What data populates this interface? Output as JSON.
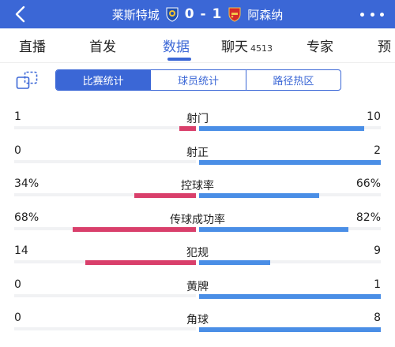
{
  "header": {
    "home_team": "莱斯特城",
    "away_team": "阿森纳",
    "score": "0 - 1",
    "home_badge_icon": "leicester-badge-icon",
    "away_badge_icon": "arsenal-badge-icon",
    "bg_color": "#3b67d6"
  },
  "tabs": [
    {
      "label": "直播",
      "count": ""
    },
    {
      "label": "首发",
      "count": ""
    },
    {
      "label": "数据",
      "count": "",
      "active": true
    },
    {
      "label": "聊天",
      "count": "4513"
    },
    {
      "label": "专家",
      "count": ""
    },
    {
      "label": "预",
      "count": ""
    }
  ],
  "subtabs": [
    {
      "label": "比赛统计",
      "active": true
    },
    {
      "label": "球员统计",
      "active": false
    },
    {
      "label": "路径热区",
      "active": false
    }
  ],
  "colors": {
    "home_bar": "#d93f6b",
    "away_bar": "#4a8ee6",
    "accent": "#3b67d6"
  },
  "stats": [
    {
      "label": "射门",
      "home": "1",
      "away": "10",
      "home_share": 0.09,
      "away_share": 0.91
    },
    {
      "label": "射正",
      "home": "0",
      "away": "2",
      "home_share": 0.0,
      "away_share": 1.0
    },
    {
      "label": "控球率",
      "home": "34%",
      "away": "66%",
      "home_share": 0.34,
      "away_share": 0.66
    },
    {
      "label": "传球成功率",
      "home": "68%",
      "away": "82%",
      "home_share": 0.68,
      "away_share": 0.82
    },
    {
      "label": "犯规",
      "home": "14",
      "away": "9",
      "home_share": 0.61,
      "away_share": 0.39
    },
    {
      "label": "黄牌",
      "home": "0",
      "away": "1",
      "home_share": 0.0,
      "away_share": 1.0
    },
    {
      "label": "角球",
      "home": "0",
      "away": "8",
      "home_share": 0.0,
      "away_share": 1.0
    }
  ]
}
